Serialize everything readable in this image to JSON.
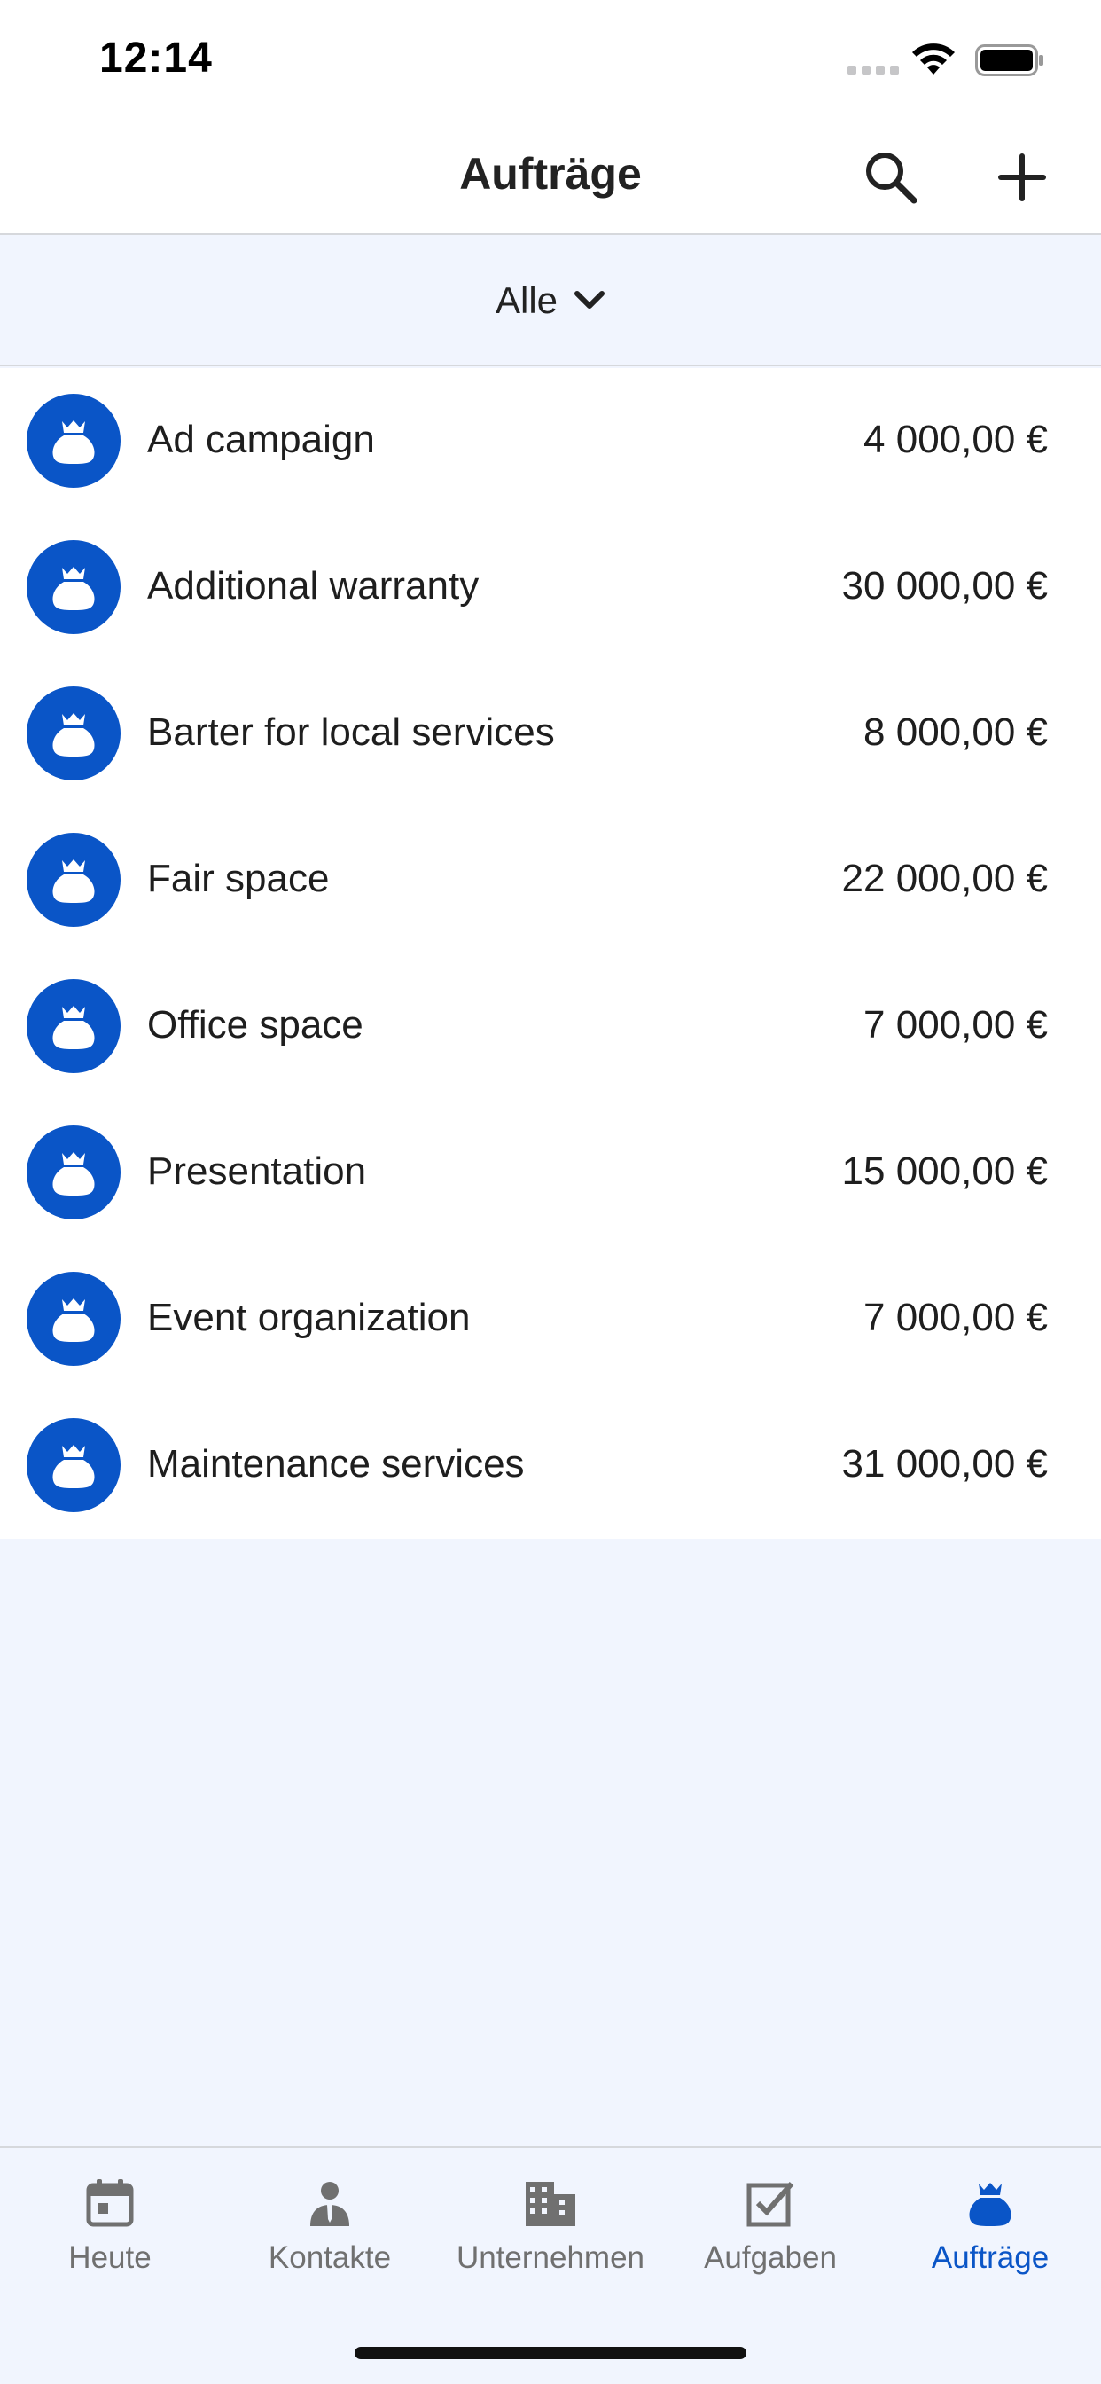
{
  "status_bar": {
    "time": "12:14"
  },
  "nav": {
    "title": "Aufträge",
    "search_icon": "search-icon",
    "add_icon": "plus-icon"
  },
  "filter": {
    "label": "Alle",
    "icon": "chevron-down-icon"
  },
  "deals": [
    {
      "name": "Ad campaign",
      "amount": "4 000,00 €"
    },
    {
      "name": "Additional warranty",
      "amount": "30 000,00 €"
    },
    {
      "name": "Barter for local services",
      "amount": "8 000,00 €"
    },
    {
      "name": "Fair space",
      "amount": "22 000,00 €"
    },
    {
      "name": "Office space",
      "amount": "7 000,00 €"
    },
    {
      "name": "Presentation",
      "amount": "15 000,00 €"
    },
    {
      "name": "Event organization",
      "amount": "7 000,00 €"
    },
    {
      "name": "Maintenance services",
      "amount": "31 000,00 €"
    }
  ],
  "tabs": [
    {
      "label": "Heute",
      "icon": "calendar-icon",
      "active": false
    },
    {
      "label": "Kontakte",
      "icon": "person-icon",
      "active": false
    },
    {
      "label": "Unternehmen",
      "icon": "building-icon",
      "active": false
    },
    {
      "label": "Aufgaben",
      "icon": "checkbox-icon",
      "active": false
    },
    {
      "label": "Aufträge",
      "icon": "money-bag-icon",
      "active": true
    }
  ],
  "colors": {
    "accent": "#0a55c7",
    "background": "#f1f5fe",
    "inactive": "#707070"
  }
}
